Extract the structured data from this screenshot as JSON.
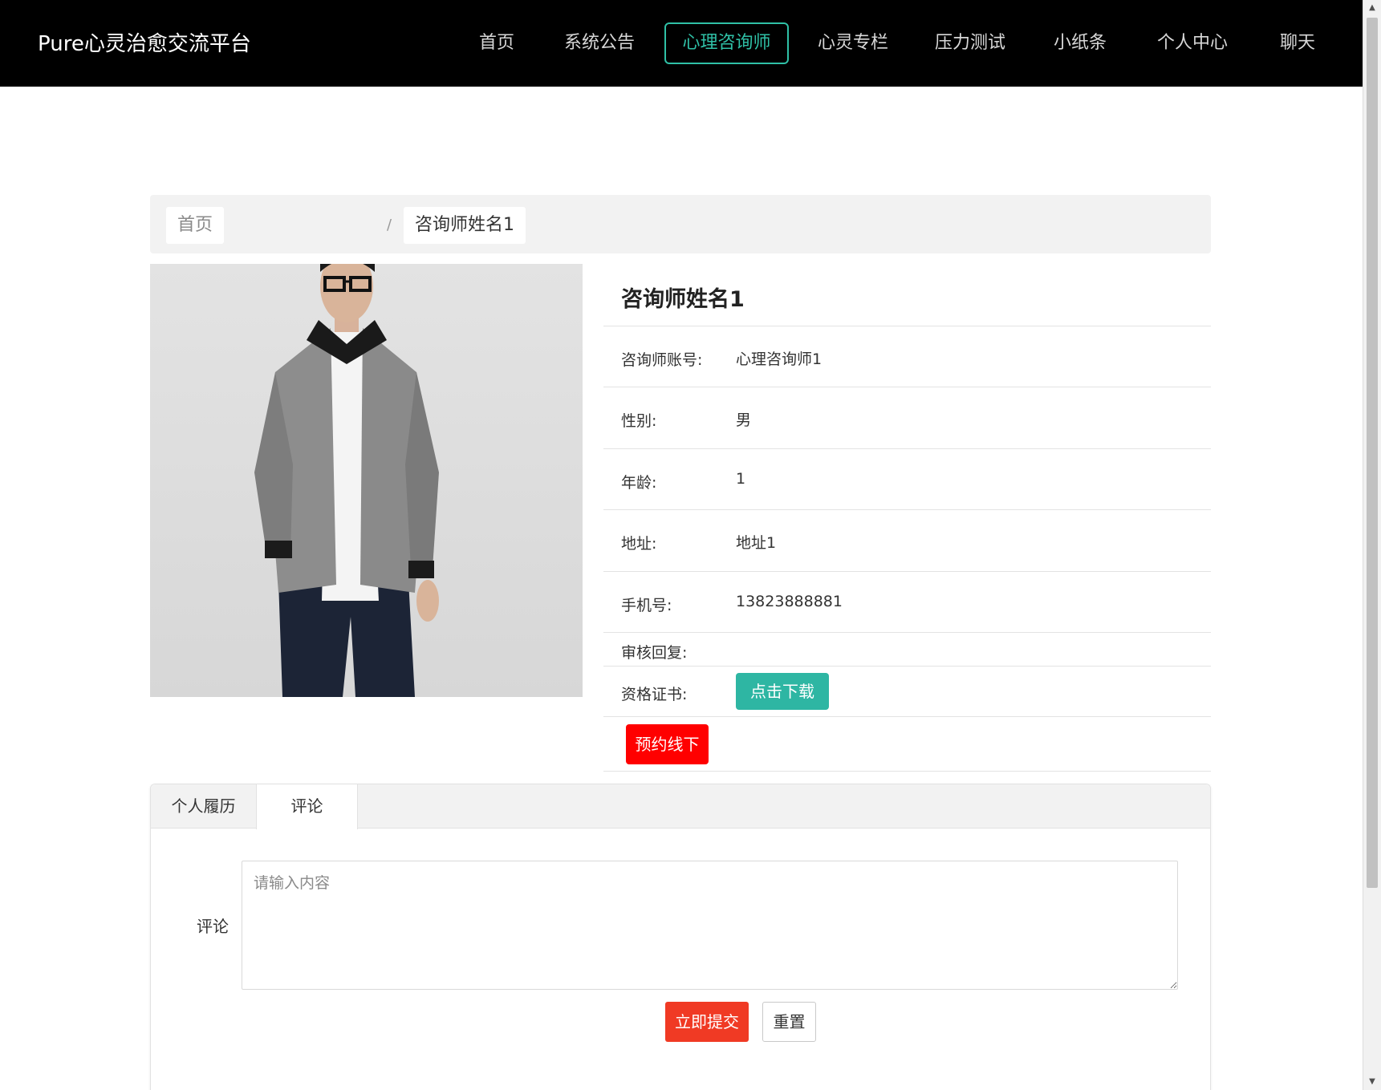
{
  "header": {
    "brand": "Pure心灵治愈交流平台",
    "nav": [
      {
        "label": "首页",
        "active": false
      },
      {
        "label": "系统公告",
        "active": false
      },
      {
        "label": "心理咨询师",
        "active": true
      },
      {
        "label": "心灵专栏",
        "active": false
      },
      {
        "label": "压力测试",
        "active": false
      },
      {
        "label": "小纸条",
        "active": false
      },
      {
        "label": "个人中心",
        "active": false
      },
      {
        "label": "聊天",
        "active": false
      }
    ]
  },
  "breadcrumb": {
    "home": "首页",
    "separator": "/",
    "current": "咨询师姓名1"
  },
  "profile": {
    "name": "咨询师姓名1",
    "fields": [
      {
        "label": "咨询师账号:",
        "value": "心理咨询师1"
      },
      {
        "label": "性别:",
        "value": "男"
      },
      {
        "label": "年龄:",
        "value": "1"
      },
      {
        "label": "地址:",
        "value": "地址1"
      },
      {
        "label": "手机号:",
        "value": "13823888881"
      },
      {
        "label": "审核回复:",
        "value": ""
      }
    ],
    "certificate_label": "资格证书:",
    "download_label": "点击下载",
    "book_label": "预约线下"
  },
  "tabs": {
    "items": [
      {
        "label": "个人履历",
        "active": false
      },
      {
        "label": "评论",
        "active": true
      }
    ]
  },
  "comment": {
    "label": "评论",
    "placeholder": "请输入内容",
    "submit_label": "立即提交",
    "reset_label": "重置"
  },
  "colors": {
    "accent": "#2fc0a6",
    "danger": "#ff0000",
    "submit": "#f03a24"
  }
}
